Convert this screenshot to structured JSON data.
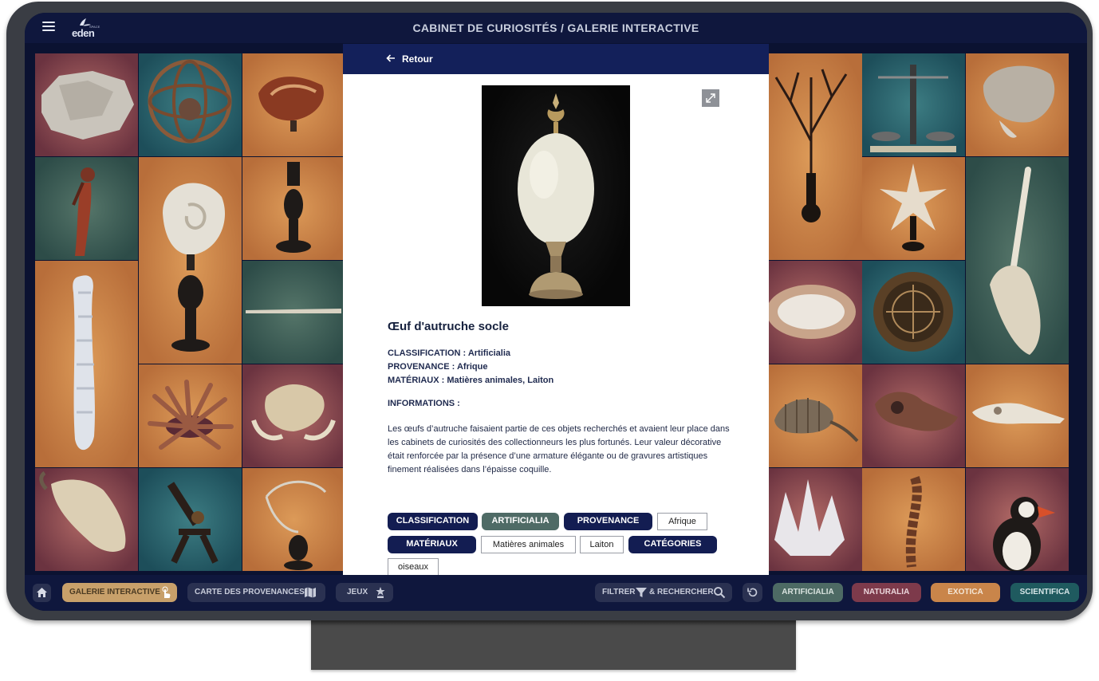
{
  "header": {
    "title": "CABINET DE CURIOSITÉS / GALERIE INTERACTIVE",
    "logo_text": "eden",
    "logo_sub": "SPACE"
  },
  "gallery": {
    "tiles": [
      {
        "name": "tile-crystal-rock",
        "color": "maroon"
      },
      {
        "name": "tile-armillary-sphere",
        "color": "teal"
      },
      {
        "name": "tile-nautilus-cup",
        "color": "ochre"
      },
      {
        "name": "tile-mermaid-figure",
        "color": "green"
      },
      {
        "name": "tile-nautilus-shell",
        "color": "ochre"
      },
      {
        "name": "tile-narwhal-tusk",
        "color": "green"
      },
      {
        "name": "tile-coral-branch",
        "color": "ochre"
      },
      {
        "name": "tile-scale-balance",
        "color": "teal"
      },
      {
        "name": "tile-fossil-stone",
        "color": "ochre"
      },
      {
        "name": "tile-sponge",
        "color": "ochre"
      },
      {
        "name": "tile-starfish",
        "color": "ochre"
      },
      {
        "name": "tile-unicorn-skull",
        "color": "green"
      },
      {
        "name": "tile-sea-urchin",
        "color": "ochre"
      },
      {
        "name": "tile-boar-skull",
        "color": "maroon"
      },
      {
        "name": "tile-geode",
        "color": "maroon"
      },
      {
        "name": "tile-compass",
        "color": "teal"
      },
      {
        "name": "tile-cow-skull",
        "color": "maroon"
      },
      {
        "name": "tile-microscope",
        "color": "teal"
      },
      {
        "name": "tile-bird-cage",
        "color": "ochre"
      },
      {
        "name": "tile-armadillo",
        "color": "ochre"
      },
      {
        "name": "tile-dodo-skull",
        "color": "maroon"
      },
      {
        "name": "tile-crocodile-skull",
        "color": "ochre"
      },
      {
        "name": "tile-quartz-cluster",
        "color": "maroon"
      },
      {
        "name": "tile-vertebrae",
        "color": "ochre"
      },
      {
        "name": "tile-puffin",
        "color": "maroon"
      }
    ],
    "colors": {
      "maroon": "#8a4a52",
      "teal": "#2c6470",
      "ochre": "#c9824a",
      "green": "#3f6058"
    }
  },
  "modal": {
    "back_label": "Retour",
    "back_icon": "arrow-left-icon",
    "expand_icon": "expand-icon",
    "title": "Œuf d'autruche socle",
    "classification_line": "CLASSIFICATION : Artificialia",
    "provenance_line": "PROVENANCE : Afrique",
    "materiaux_line": "MATÉRIAUX : Matières animales, Laiton",
    "info_heading": "INFORMATIONS :",
    "description": "Les œufs d’autruche faisaient partie de ces objets recherchés et avaient leur place dans les cabinets de curiosités des collectionneurs les plus fortunés. Leur valeur décorative était renforcée par la présence d’une armature élégante ou de gravures artistiques finement réalisées dans l’épaisse coquille.",
    "tags": {
      "classification": "CLASSIFICATION",
      "artificialia": "ARTIFICIALIA",
      "provenance": "PROVENANCE",
      "afrique": "Afrique",
      "materiaux": "MATÉRIAUX",
      "matieres_animales": "Matières animales",
      "laiton": "Laiton",
      "categories": "CATÉGORIES",
      "oiseaux": "oiseaux"
    }
  },
  "bottombar": {
    "home_icon": "home-icon",
    "galerie": "GALERIE INTERACTIVE",
    "carte": "CARTE DES PROVENANCES",
    "jeux": "JEUX",
    "filtrer": "FILTRER",
    "rechercher": "& RECHERCHER",
    "reset_icon": "reset-icon",
    "artificialia": "ARTIFICIALIA",
    "naturalia": "NATURALIA",
    "exotica": "EXOTICA",
    "scientifica": "SCIENTIFICA",
    "colors": {
      "artificialia": "#4d6a64",
      "naturalia": "#7d3a4b",
      "exotica": "#c9854a",
      "scientifica": "#1f5a5f",
      "galerie": "#c8a06a"
    }
  }
}
